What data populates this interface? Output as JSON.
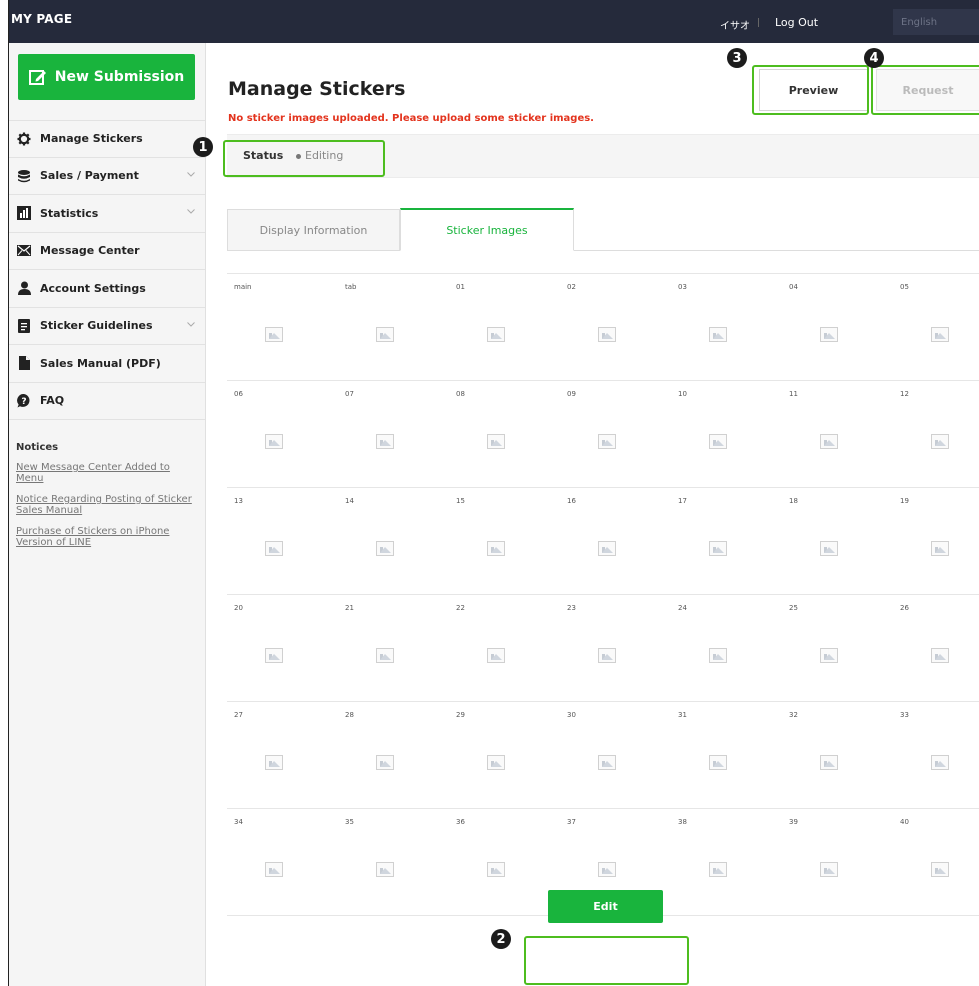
{
  "topbar": {
    "brand": "MY PAGE",
    "user": "イサオ",
    "logout": "Log Out",
    "language": "English"
  },
  "sidebar": {
    "new_submission": "New Submission",
    "items": [
      {
        "label": "Manage Stickers",
        "icon": "gear-icon",
        "has_submenu": false
      },
      {
        "label": "Sales / Payment",
        "icon": "coins-icon",
        "has_submenu": true
      },
      {
        "label": "Statistics",
        "icon": "bar-chart-icon",
        "has_submenu": true
      },
      {
        "label": "Message Center",
        "icon": "envelope-icon",
        "has_submenu": false
      },
      {
        "label": "Account Settings",
        "icon": "user-icon",
        "has_submenu": false
      },
      {
        "label": "Sticker Guidelines",
        "icon": "document-icon",
        "has_submenu": true
      },
      {
        "label": "Sales Manual (PDF)",
        "icon": "file-icon",
        "has_submenu": false
      },
      {
        "label": "FAQ",
        "icon": "question-icon",
        "has_submenu": false
      }
    ],
    "notices": {
      "title": "Notices",
      "links": [
        "New Message Center Added to Menu",
        "Notice Regarding Posting of Sticker Sales Manual",
        "Purchase of Stickers on iPhone Version of LINE"
      ]
    }
  },
  "main": {
    "title": "Manage Stickers",
    "warning": "No sticker images uploaded. Please upload some sticker images.",
    "preview_label": "Preview",
    "request_label": "Request",
    "status_label": "Status",
    "status_value": "Editing",
    "tabs": [
      "Display Information",
      "Sticker Images"
    ],
    "active_tab": "Sticker Images",
    "slots": [
      "main",
      "tab",
      "01",
      "02",
      "03",
      "04",
      "05",
      "06",
      "07",
      "08",
      "09",
      "10",
      "11",
      "12",
      "13",
      "14",
      "15",
      "16",
      "17",
      "18",
      "19",
      "20",
      "21",
      "22",
      "23",
      "24",
      "25",
      "26",
      "27",
      "28",
      "29",
      "30",
      "31",
      "32",
      "33",
      "34",
      "35",
      "36",
      "37",
      "38",
      "39",
      "40"
    ],
    "edit_label": "Edit"
  },
  "annotations": [
    "1",
    "2",
    "3",
    "4"
  ],
  "colors": {
    "topbar": "#252a3b",
    "accent_green": "#19b43d",
    "annotation_green": "#4dbd1f",
    "warning_red": "#e3331d"
  }
}
